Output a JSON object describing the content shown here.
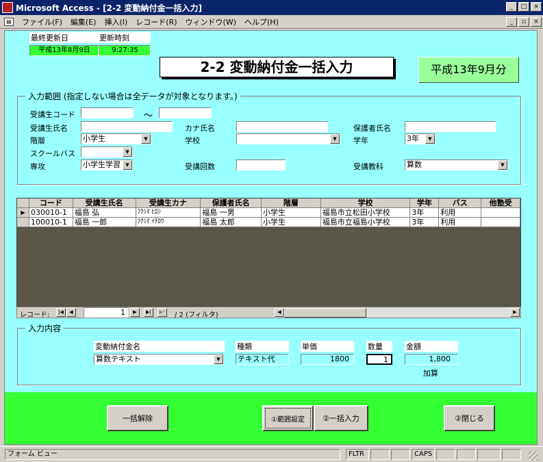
{
  "window": {
    "title": "Microsoft Access - [2-2 変動納付金一括入力]",
    "min": "_",
    "max": "□",
    "close": "×"
  },
  "menu": {
    "items": [
      "ファイル(F)",
      "編集(E)",
      "挿入(I)",
      "レコード(R)",
      "ウィンドウ(W)",
      "ヘルプ(H)"
    ],
    "doc_min": "_",
    "doc_restore": "▫",
    "doc_close": "×"
  },
  "update": {
    "date_label": "最終更新日",
    "time_label": "更新時刻",
    "date_value": "平成13年8月9日",
    "time_value": "9:27:35"
  },
  "form_title": "2-2 変動納付金一括入力",
  "period": "平成13年9月分",
  "range": {
    "legend": "入力範囲 (指定しない場合は全データが対象となります。)",
    "student_code_label": "受講生コード",
    "tilde": "～",
    "code_from": "",
    "code_to": "",
    "student_name_label": "受講生氏名",
    "student_name": "",
    "kana_label": "カナ氏名",
    "kana": "",
    "guardian_label": "保護者氏名",
    "guardian": "",
    "level_label": "階層",
    "level": "小学生",
    "school_label": "学校",
    "school": "",
    "grade_label": "学年",
    "grade": "3年",
    "bus_label": "スクールバス",
    "bus": "",
    "major_label": "専攻",
    "major": "小学生学習",
    "count_label": "受講回数",
    "count": "",
    "subject_label": "受講教科",
    "subject": "算数"
  },
  "grid": {
    "headers": [
      "コード",
      "受講生氏名",
      "受講生カナ",
      "保護者氏名",
      "階層",
      "学校",
      "学年",
      "バス",
      "他塾受"
    ],
    "rows": [
      [
        "030010-1",
        "福島 弘",
        "ﾌｸｼﾏ ﾋﾛｼ",
        "福島 一男",
        "小学生",
        "福島市立松田小学校",
        "3年",
        "利用",
        ""
      ],
      [
        "100010-1",
        "福島 一郎",
        "ﾌｸｼﾏ ｲﾁﾛｳ",
        "福島 太郎",
        "小学生",
        "福島市立福島小学校",
        "3年",
        "利用",
        ""
      ]
    ],
    "current_marker": "▶"
  },
  "nav": {
    "record_label": "レコード:",
    "current": "1",
    "total": "/ 2 (フィルタ)",
    "first": "|◀",
    "prev": "◀",
    "next": "▶",
    "last": "▶|",
    "new": "▶*"
  },
  "input": {
    "legend": "入力内容",
    "fee_name_label": "変動納付金名",
    "fee_name": "算数テキスト",
    "type_label": "種類",
    "type": "テキスト代",
    "unit_label": "単価",
    "unit": "1800",
    "qty_label": "数量",
    "qty": "1",
    "amount_label": "金額",
    "amount": "1,800",
    "add_label": "加算"
  },
  "buttons": {
    "cancel_all": "一括解除",
    "set_range": "①範囲設定",
    "bulk_input": "②一括入力",
    "close": "②閉じる"
  },
  "status": {
    "view": "フォーム ビュー",
    "fltr": "FLTR",
    "caps": "CAPS"
  }
}
